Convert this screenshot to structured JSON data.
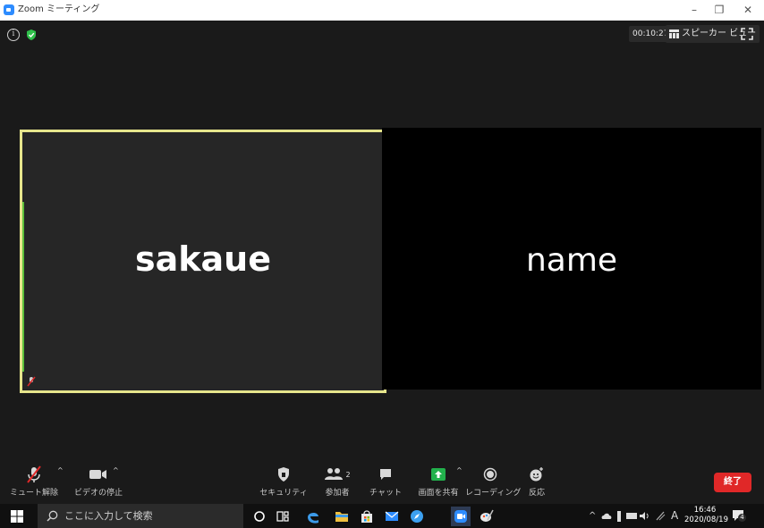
{
  "window": {
    "title": "Zoom ミーティング",
    "minimize": "–",
    "restore": "❐",
    "close": "✕"
  },
  "topbar": {
    "info_glyph": "i",
    "timer": "00:10:27",
    "speaker_view_label": "スピーカー ビュー"
  },
  "participants": [
    {
      "name": "sakaue",
      "active_speaker": true
    },
    {
      "name": "name",
      "active_speaker": false
    }
  ],
  "toolbar": {
    "unmute_label": "ミュート解除",
    "stop_video_label": "ビデオの停止",
    "security_label": "セキュリティ",
    "participants_label": "参加者",
    "participants_count": "2",
    "chat_label": "チャット",
    "share_screen_label": "画面を共有",
    "recording_label": "レコーディング",
    "reactions_label": "反応",
    "end_label": "終了",
    "caret": "^"
  },
  "taskbar": {
    "search_placeholder": "ここに入力して検索",
    "tray_caret": "^",
    "ime_indicator": "A",
    "time": "16:46",
    "date": "2020/08/19",
    "notification_count": "4"
  },
  "colors": {
    "active_speaker_border": "#e6e58c",
    "end_button": "#e02828",
    "share_green": "#22b14c",
    "zoom_blue": "#2d8cff"
  }
}
